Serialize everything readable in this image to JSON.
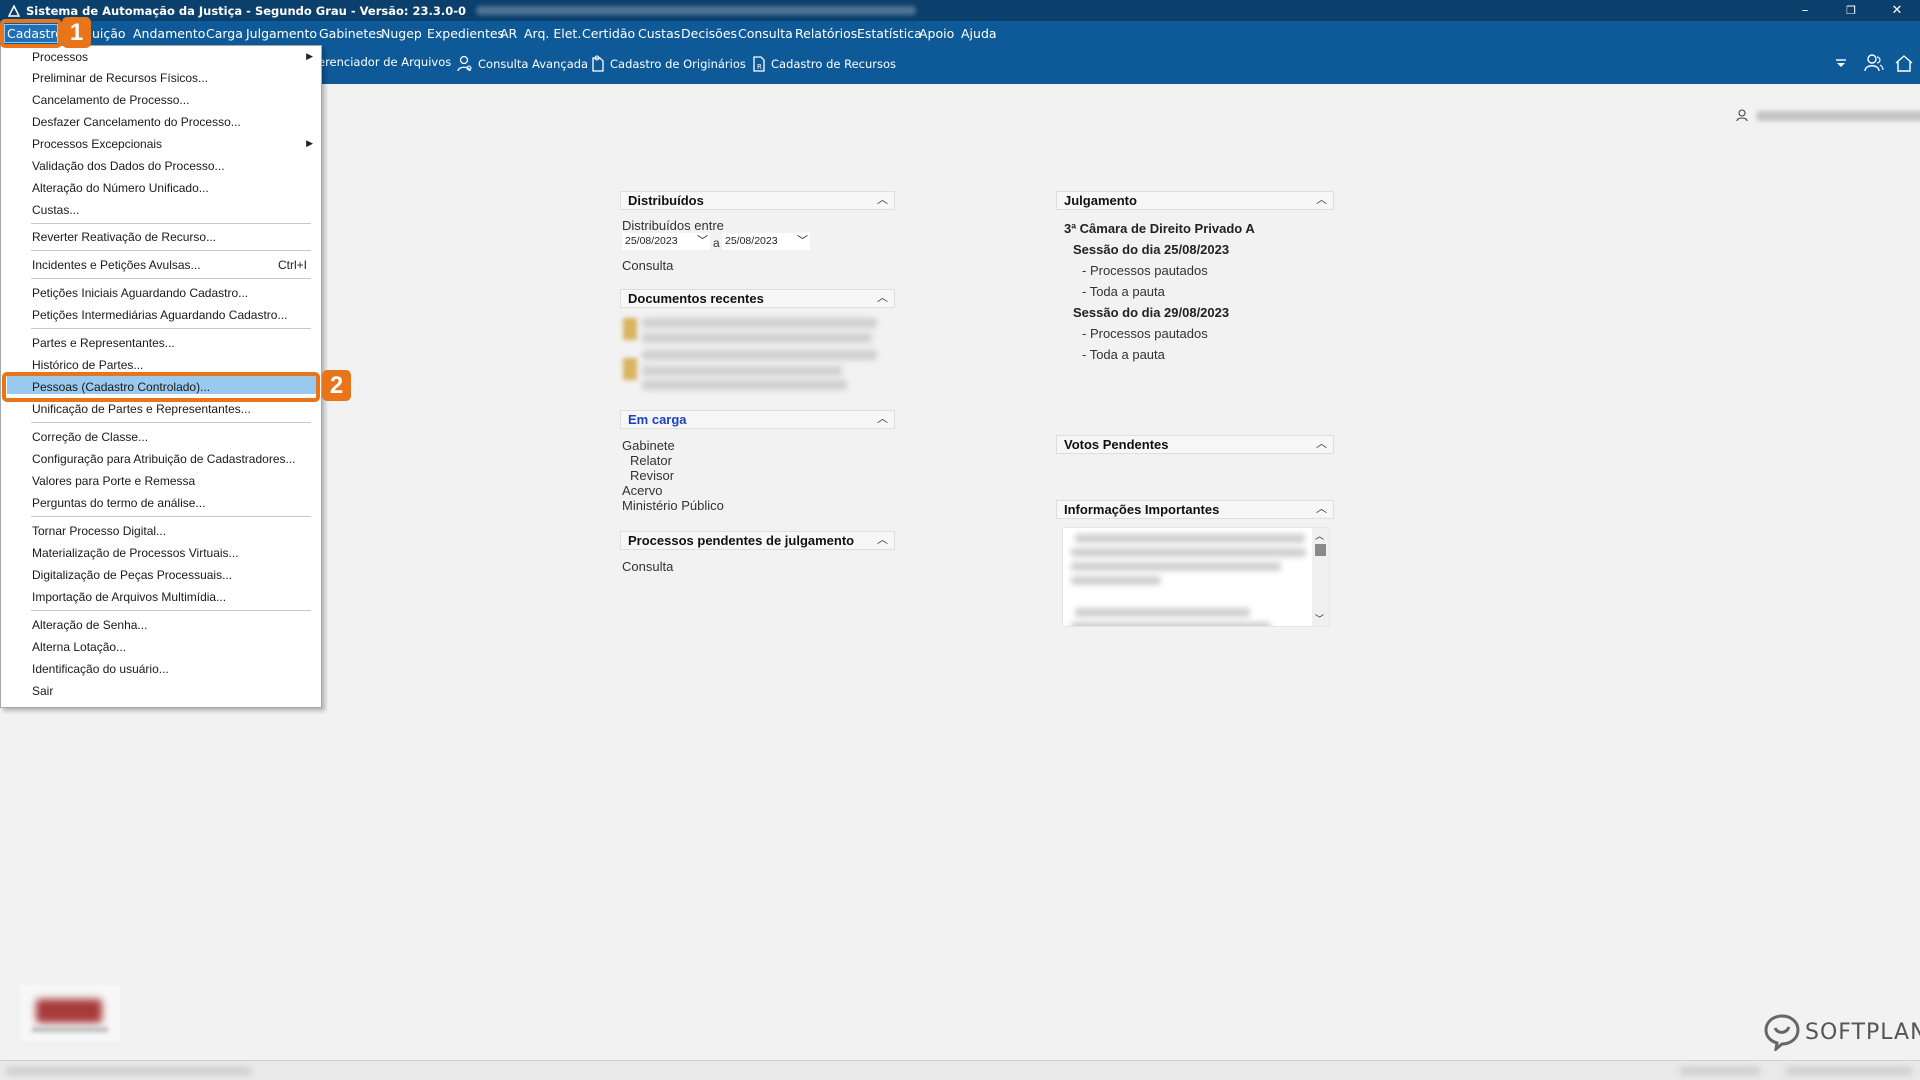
{
  "window": {
    "title": "Sistema de Automação da Justiça - Segundo Grau - Versão: 23.3.0-0",
    "controls": {
      "minimize": "–",
      "restore": "❐",
      "close": "✕"
    }
  },
  "menubar": {
    "active": "Cadastro",
    "items": [
      "uição",
      "Andamento",
      "Carga",
      "Julgamento",
      "Gabinetes",
      "Nugep",
      "Expedientes",
      "AR",
      "Arq. Elet.",
      "Certidão",
      "Custas",
      "Decisões",
      "Consulta",
      "Relatórios",
      "Estatística",
      "Apoio",
      "Ajuda"
    ]
  },
  "toolbar": {
    "items": [
      "erenciador de Arquivos",
      "Consulta Avançada",
      "Cadastro de Originários",
      "Cadastro de Recursos"
    ]
  },
  "dropdown": {
    "items": [
      "Processos",
      "Preliminar de Recursos Físicos...",
      "Cancelamento de Processo...",
      "Desfazer Cancelamento do Processo...",
      "Processos Excepcionais",
      "Validação dos Dados do Processo...",
      "Alteração do Número Unificado...",
      "Custas...",
      "Reverter Reativação de Recurso...",
      "Incidentes e Petições Avulsas...",
      "Petições Iniciais Aguardando Cadastro...",
      "Petições Intermediárias Aguardando Cadastro...",
      "Partes e Representantes...",
      "Histórico de Partes...",
      "Pessoas (Cadastro Controlado)...",
      "Unificação de Partes e Representantes...",
      "Correção de Classe...",
      "Configuração para Atribuição de Cadastradores...",
      "Valores para Porte e Remessa",
      "Perguntas do termo de análise...",
      "Tornar Processo Digital...",
      "Materialização de Processos Virtuais...",
      "Digitalização de Peças Processuais...",
      "Importação de Arquivos Multimídia...",
      "Alteração de Senha...",
      "Alterna Lotação...",
      "Identificação do usuário...",
      "Sair"
    ],
    "shortcut_incidentes": "Ctrl+I",
    "highlighted": "Pessoas (Cadastro Controlado)..."
  },
  "callouts": [
    "1",
    "2"
  ],
  "panels": {
    "distribuidos": {
      "title": "Distribuídos",
      "label": "Distribuídos entre",
      "date_from": "25/08/2023",
      "date_sep": "a",
      "date_to": "25/08/2023",
      "link": "Consulta"
    },
    "documentos": {
      "title": "Documentos recentes"
    },
    "em_carga": {
      "title": "Em carga",
      "lines": [
        "Gabinete",
        "Relator",
        "Revisor",
        "Acervo",
        "Ministério Público"
      ]
    },
    "pendentes": {
      "title": "Processos pendentes de julgamento",
      "link": "Consulta"
    },
    "julgamento": {
      "title": "Julgamento",
      "camara": "3ª Câmara de Direito Privado A",
      "sessao1": "Sessão do dia 25/08/2023",
      "sessao1_items": [
        "- Processos pautados",
        "- Toda a pauta"
      ],
      "sessao2": "Sessão do dia 29/08/2023",
      "sessao2_items": [
        "- Processos pautados",
        "- Toda a pauta"
      ]
    },
    "votos": {
      "title": "Votos Pendentes"
    },
    "informacoes": {
      "title": "Informações Importantes"
    }
  },
  "footer": {
    "brand": "SOFTPLAN"
  },
  "colors": {
    "menubar": "#0e5a99",
    "titlebar": "#0b3f6c",
    "callout": "#e8751a",
    "highlight": "#99c9ef"
  }
}
